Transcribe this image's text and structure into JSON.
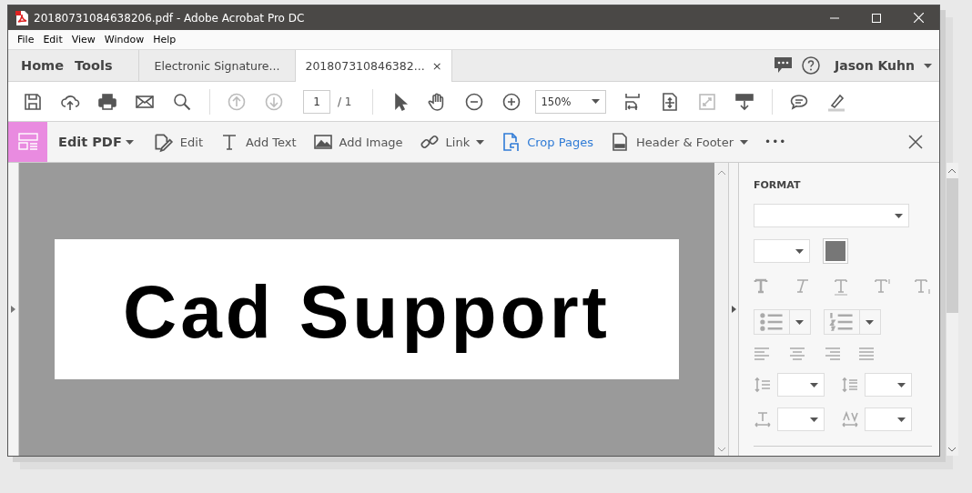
{
  "window": {
    "title": "20180731084638206.pdf - Adobe Acrobat Pro DC"
  },
  "menu": [
    "File",
    "Edit",
    "View",
    "Window",
    "Help"
  ],
  "nav": [
    "Home",
    "Tools"
  ],
  "tabs": [
    {
      "label": "Electronic Signature...",
      "selected": false
    },
    {
      "label": "201807310846382...",
      "selected": true,
      "close": "×"
    }
  ],
  "user": "Jason Kuhn",
  "page_nav": [
    {
      "disabled": true
    },
    {
      "disabled": true
    }
  ],
  "full_screen": {
    "disabled": true
  },
  "page": {
    "current": "1",
    "total": "/ 1"
  },
  "zoom": "150%",
  "edit_toolbar": {
    "title": "Edit PDF",
    "more": "•••",
    "tools": [
      {
        "label": "Edit",
        "dropdown": false,
        "selected": false
      },
      {
        "label": "Add Text",
        "dropdown": false,
        "selected": false
      },
      {
        "label": "Add Image",
        "dropdown": false,
        "selected": false
      },
      {
        "label": "Link",
        "dropdown": true,
        "selected": false
      },
      {
        "label": "Crop Pages",
        "dropdown": false,
        "selected": true
      },
      {
        "label": "Header & Footer",
        "dropdown": true,
        "selected": false
      }
    ]
  },
  "document": {
    "signature": "Cad Support"
  },
  "format_panel": {
    "heading": "FORMAT"
  }
}
